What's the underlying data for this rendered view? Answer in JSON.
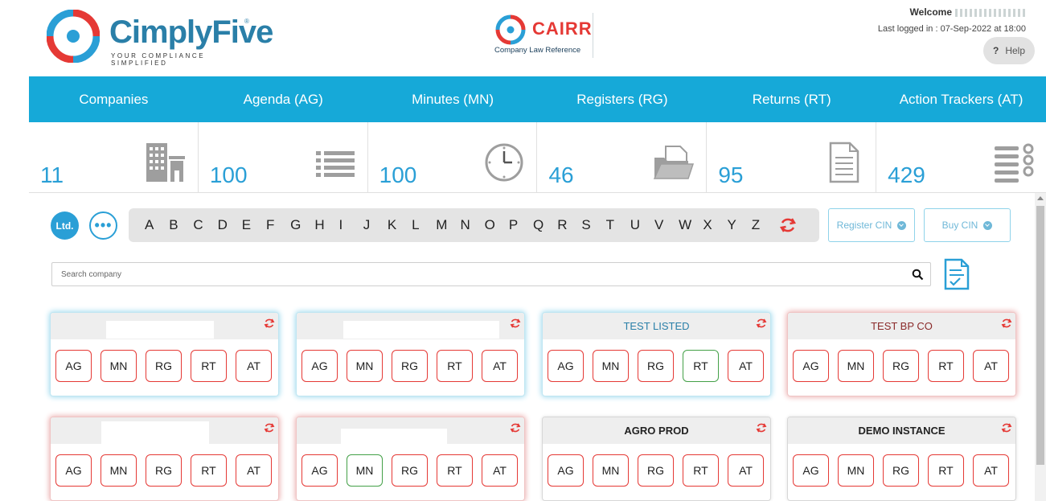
{
  "brand": {
    "name": "CimplyFive",
    "tagline": "YOUR COMPLIANCE SIMPLIFIED",
    "reg_mark": "®",
    "color_primary": "#2a7fa8",
    "color_red": "#e53935"
  },
  "cairr": {
    "title": "CAIRR",
    "subtitle": "Company Law Reference"
  },
  "user": {
    "welcome_label": "Welcome",
    "last_logged": "Last logged in : 07-Sep-2022 at 18:00",
    "help_label": "Help",
    "help_glyph": "?"
  },
  "nav": {
    "items": [
      {
        "label": "Companies"
      },
      {
        "label": "Agenda (AG)"
      },
      {
        "label": "Minutes (MN)"
      },
      {
        "label": "Registers (RG)"
      },
      {
        "label": "Returns (RT)"
      },
      {
        "label": "Action Trackers (AT)"
      }
    ],
    "color": "#16a9d8"
  },
  "stats": [
    {
      "value": "11",
      "icon": "building-icon"
    },
    {
      "value": "100",
      "icon": "list-icon"
    },
    {
      "value": "100",
      "icon": "clock-icon"
    },
    {
      "value": "46",
      "icon": "folder-icon"
    },
    {
      "value": "95",
      "icon": "document-icon"
    },
    {
      "value": "429",
      "icon": "checklist-icon"
    }
  ],
  "filters": {
    "ltd_label": "Ltd.",
    "more_label": "•••",
    "letters": [
      "A",
      "B",
      "C",
      "D",
      "E",
      "F",
      "G",
      "H",
      "I",
      "J",
      "K",
      "L",
      "M",
      "N",
      "O",
      "P",
      "Q",
      "R",
      "S",
      "T",
      "U",
      "V",
      "W",
      "X",
      "Y",
      "Z"
    ],
    "register_cin_label": "Register CIN",
    "buy_cin_label": "Buy CIN"
  },
  "search": {
    "placeholder": "Search company"
  },
  "companies": [
    {
      "name": "",
      "style": "blue",
      "codes": [
        {
          "label": "AG",
          "state": "red"
        },
        {
          "label": "MN",
          "state": "red"
        },
        {
          "label": "RG",
          "state": "red"
        },
        {
          "label": "RT",
          "state": "red"
        },
        {
          "label": "AT",
          "state": "red"
        }
      ]
    },
    {
      "name": "",
      "style": "blue",
      "codes": [
        {
          "label": "AG",
          "state": "red"
        },
        {
          "label": "MN",
          "state": "red"
        },
        {
          "label": "RG",
          "state": "red"
        },
        {
          "label": "RT",
          "state": "red"
        },
        {
          "label": "AT",
          "state": "red"
        }
      ]
    },
    {
      "name": "TEST LISTED",
      "style": "blue",
      "codes": [
        {
          "label": "AG",
          "state": "red"
        },
        {
          "label": "MN",
          "state": "red"
        },
        {
          "label": "RG",
          "state": "red"
        },
        {
          "label": "RT",
          "state": "green"
        },
        {
          "label": "AT",
          "state": "red"
        }
      ]
    },
    {
      "name": "TEST BP CO",
      "style": "red",
      "codes": [
        {
          "label": "AG",
          "state": "red"
        },
        {
          "label": "MN",
          "state": "red"
        },
        {
          "label": "RG",
          "state": "red"
        },
        {
          "label": "RT",
          "state": "red"
        },
        {
          "label": "AT",
          "state": "red"
        }
      ]
    },
    {
      "name": "",
      "style": "red",
      "codes": [
        {
          "label": "AG",
          "state": "red"
        },
        {
          "label": "MN",
          "state": "red"
        },
        {
          "label": "RG",
          "state": "red"
        },
        {
          "label": "RT",
          "state": "red"
        },
        {
          "label": "AT",
          "state": "red"
        }
      ]
    },
    {
      "name": "",
      "style": "red",
      "codes": [
        {
          "label": "AG",
          "state": "red"
        },
        {
          "label": "MN",
          "state": "green"
        },
        {
          "label": "RG",
          "state": "red"
        },
        {
          "label": "RT",
          "state": "red"
        },
        {
          "label": "AT",
          "state": "red"
        }
      ]
    },
    {
      "name": "AGRO PROD",
      "style": "gray",
      "codes": [
        {
          "label": "AG",
          "state": "red"
        },
        {
          "label": "MN",
          "state": "red"
        },
        {
          "label": "RG",
          "state": "red"
        },
        {
          "label": "RT",
          "state": "red"
        },
        {
          "label": "AT",
          "state": "red"
        }
      ]
    },
    {
      "name": "DEMO INSTANCE",
      "style": "gray",
      "codes": [
        {
          "label": "AG",
          "state": "red"
        },
        {
          "label": "MN",
          "state": "red"
        },
        {
          "label": "RG",
          "state": "red"
        },
        {
          "label": "RT",
          "state": "red"
        },
        {
          "label": "AT",
          "state": "red"
        }
      ]
    }
  ]
}
